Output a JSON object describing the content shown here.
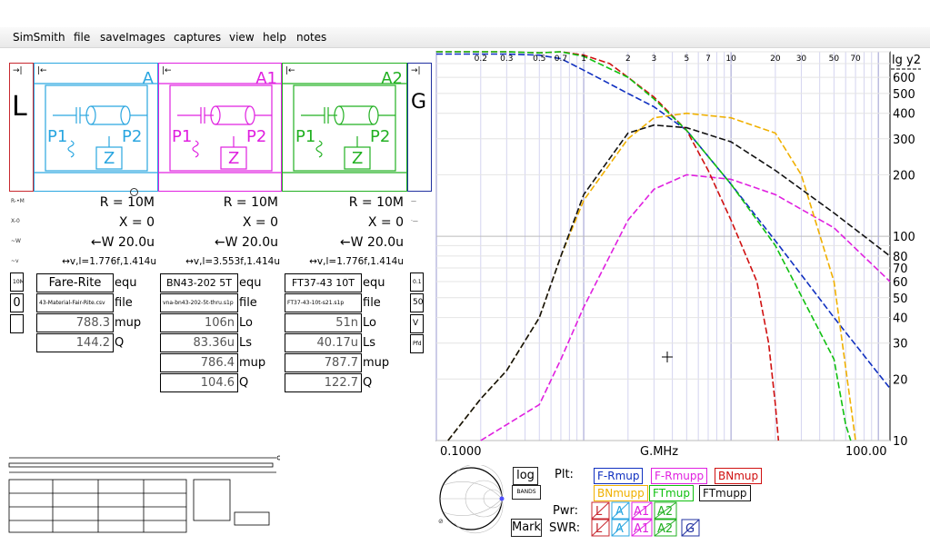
{
  "menu": [
    "SimSmith",
    "file",
    "saveImages",
    "captures",
    "view",
    "help",
    "notes"
  ],
  "blocks": {
    "L": {
      "label": "L",
      "color": "#c8282f"
    },
    "A": {
      "label": "A",
      "p1": "P1",
      "p2": "P2",
      "z": "Z",
      "color": "#2aa6e0"
    },
    "A1": {
      "label": "A1",
      "p1": "P1",
      "p2": "P2",
      "z": "Z",
      "color": "#e020e0"
    },
    "A2": {
      "label": "A2",
      "p1": "P1",
      "p2": "P2",
      "z": "Z",
      "color": "#22b022"
    },
    "G": {
      "label": "G",
      "color": "#2030a0"
    }
  },
  "param_rows": {
    "r": [
      "R = 10M",
      "R = 10M",
      "R = 10M"
    ],
    "x": [
      "X = 0",
      "X = 0",
      "X = 0"
    ],
    "w": [
      "←W 20.0u",
      "←W 20.0u",
      "←W 20.0u"
    ],
    "v": [
      "↔v,l=1.776f,1.414u",
      "↔v,l=3.553f,1.414u",
      "↔v,l=1.776f,1.414u"
    ]
  },
  "panel_a": {
    "equ": "Fare-Rite",
    "equ_label": "equ",
    "file": "43-Material-Fair-Rite.csv",
    "file_label": "file",
    "mup": "788.3",
    "mup_label": "mup",
    "q": "144.2",
    "q_label": "Q"
  },
  "panel_a1": {
    "equ": "BN43-202 5T",
    "equ_label": "equ",
    "file": "vna-bn43-202-5t-thru.s1p",
    "file_label": "file",
    "lo": "106n",
    "lo_label": "Lo",
    "ls": "83.36u",
    "ls_label": "Ls",
    "mup": "786.4",
    "mup_label": "mup",
    "q": "104.6",
    "q_label": "Q"
  },
  "panel_a2": {
    "equ": "FT37-43 10T",
    "equ_label": "equ",
    "file": "FT37-43-10t-s21.s1p",
    "file_label": "file",
    "lo": "51n",
    "lo_label": "Lo",
    "ls": "40.17u",
    "ls_label": "Ls",
    "mup": "787.7",
    "mup_label": "mup",
    "q": "122.7",
    "q_label": "Q"
  },
  "left_side": {
    "l1": "10M",
    "l2": "0",
    "g1": "0.1",
    "g2": "50",
    "g3": "V",
    "g4": "Pfd"
  },
  "chart_data": {
    "type": "line",
    "x_scale": "log",
    "y_scale": "log",
    "xlabel": "G.MHz",
    "ylabel": "lg y2",
    "xlim": [
      0.1,
      120
    ],
    "ylim": [
      10,
      800
    ],
    "x_tick_labels_bottom": [
      "0.1000",
      "100.00"
    ],
    "x_tick_labels_top": [
      "0.2",
      "0.3",
      "0.5",
      "0.7",
      "1",
      "2",
      "3",
      "5",
      "7",
      "10",
      "20",
      "30",
      "50",
      "70"
    ],
    "y_tick_labels": [
      "10",
      "20",
      "30",
      "40",
      "50",
      "60",
      "70",
      "80",
      "100",
      "200",
      "300",
      "400",
      "500",
      "600"
    ],
    "series": [
      {
        "name": "F-Rmup",
        "color": "#1030c0",
        "x": [
          0.1,
          0.3,
          0.5,
          0.7,
          1,
          2,
          3,
          5,
          10,
          20,
          50,
          120
        ],
        "y": [
          780,
          780,
          770,
          740,
          650,
          500,
          430,
          330,
          180,
          95,
          40,
          18
        ]
      },
      {
        "name": "F-Rmupp",
        "color": "#e020e0",
        "x": [
          0.2,
          0.5,
          0.7,
          1,
          2,
          3,
          5,
          10,
          20,
          50,
          120
        ],
        "y": [
          10,
          15,
          25,
          45,
          120,
          170,
          200,
          190,
          160,
          110,
          60
        ]
      },
      {
        "name": "BNmup",
        "color": "#d01010",
        "x": [
          0.1,
          0.3,
          0.5,
          0.7,
          1,
          1.5,
          2,
          3,
          5,
          7,
          10,
          15,
          18,
          20,
          21
        ],
        "y": [
          800,
          800,
          790,
          800,
          770,
          700,
          600,
          480,
          330,
          210,
          120,
          60,
          30,
          15,
          10
        ]
      },
      {
        "name": "BNmupp",
        "color": "#f0b000",
        "x": [
          0.12,
          0.2,
          0.3,
          0.5,
          0.7,
          1,
          2,
          3,
          5,
          10,
          20,
          30,
          50,
          70
        ],
        "y": [
          10,
          16,
          22,
          40,
          80,
          150,
          300,
          380,
          400,
          380,
          320,
          200,
          60,
          10
        ]
      },
      {
        "name": "FTmup",
        "color": "#10c010",
        "x": [
          0.1,
          0.3,
          0.5,
          0.7,
          1,
          2,
          3,
          5,
          10,
          20,
          50,
          60,
          65
        ],
        "y": [
          800,
          800,
          790,
          800,
          760,
          600,
          470,
          330,
          180,
          90,
          25,
          12,
          10
        ]
      },
      {
        "name": "FTmupp",
        "color": "#111111",
        "x": [
          0.12,
          0.2,
          0.3,
          0.5,
          0.7,
          1,
          2,
          3,
          5,
          10,
          20,
          50,
          120
        ],
        "y": [
          10,
          16,
          22,
          40,
          80,
          160,
          320,
          350,
          340,
          290,
          210,
          130,
          80
        ]
      }
    ]
  },
  "plot_keys": [
    "F-Rmup",
    "F-Rmupp",
    "BNmup",
    "BNmupp",
    "FTmup",
    "FTmupp"
  ],
  "plot_label": "Plt:",
  "pwr_label": "Pwr:",
  "swr_label": "SWR:",
  "pwr_boxes": [
    "L",
    "A",
    "A1",
    "A2"
  ],
  "swr_boxes": [
    "L",
    "A",
    "A1",
    "A2",
    "G"
  ],
  "log_button": "log",
  "bands_button": "BANDS",
  "mark_button": "Mark"
}
